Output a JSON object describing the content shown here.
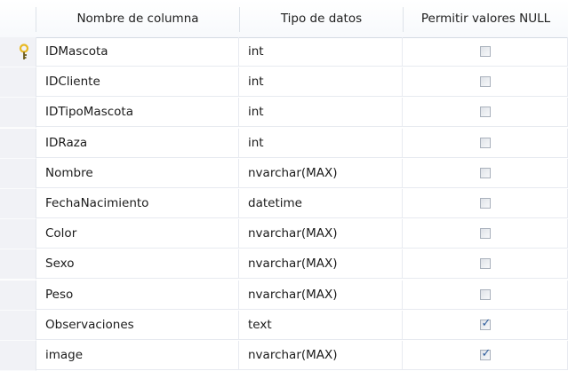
{
  "columns": {
    "name": "Nombre de columna",
    "type": "Tipo de datos",
    "nulls": "Permitir valores NULL"
  },
  "rows": [
    {
      "name": "IDMascota",
      "type": "int",
      "allow_null": false,
      "primary_key": true
    },
    {
      "name": "IDCliente",
      "type": "int",
      "allow_null": false,
      "primary_key": false
    },
    {
      "name": "IDTipoMascota",
      "type": "int",
      "allow_null": false,
      "primary_key": false
    },
    {
      "name": "IDRaza",
      "type": "int",
      "allow_null": false,
      "primary_key": false
    },
    {
      "name": "Nombre",
      "type": "nvarchar(MAX)",
      "allow_null": false,
      "primary_key": false
    },
    {
      "name": "FechaNacimiento",
      "type": "datetime",
      "allow_null": false,
      "primary_key": false
    },
    {
      "name": "Color",
      "type": "nvarchar(MAX)",
      "allow_null": false,
      "primary_key": false
    },
    {
      "name": "Sexo",
      "type": "nvarchar(MAX)",
      "allow_null": false,
      "primary_key": false
    },
    {
      "name": "Peso",
      "type": "nvarchar(MAX)",
      "allow_null": false,
      "primary_key": false
    },
    {
      "name": "Observaciones",
      "type": "text",
      "allow_null": true,
      "primary_key": false
    },
    {
      "name": "image",
      "type": "nvarchar(MAX)",
      "allow_null": true,
      "primary_key": false
    }
  ],
  "icons": {
    "primary_key": "key-icon",
    "checkbox": "checkbox"
  },
  "colors": {
    "row_selector": "#f1f2f6",
    "gridline": "#e7eaf0",
    "key": "#e8b923",
    "check": "#2f5e9e"
  }
}
